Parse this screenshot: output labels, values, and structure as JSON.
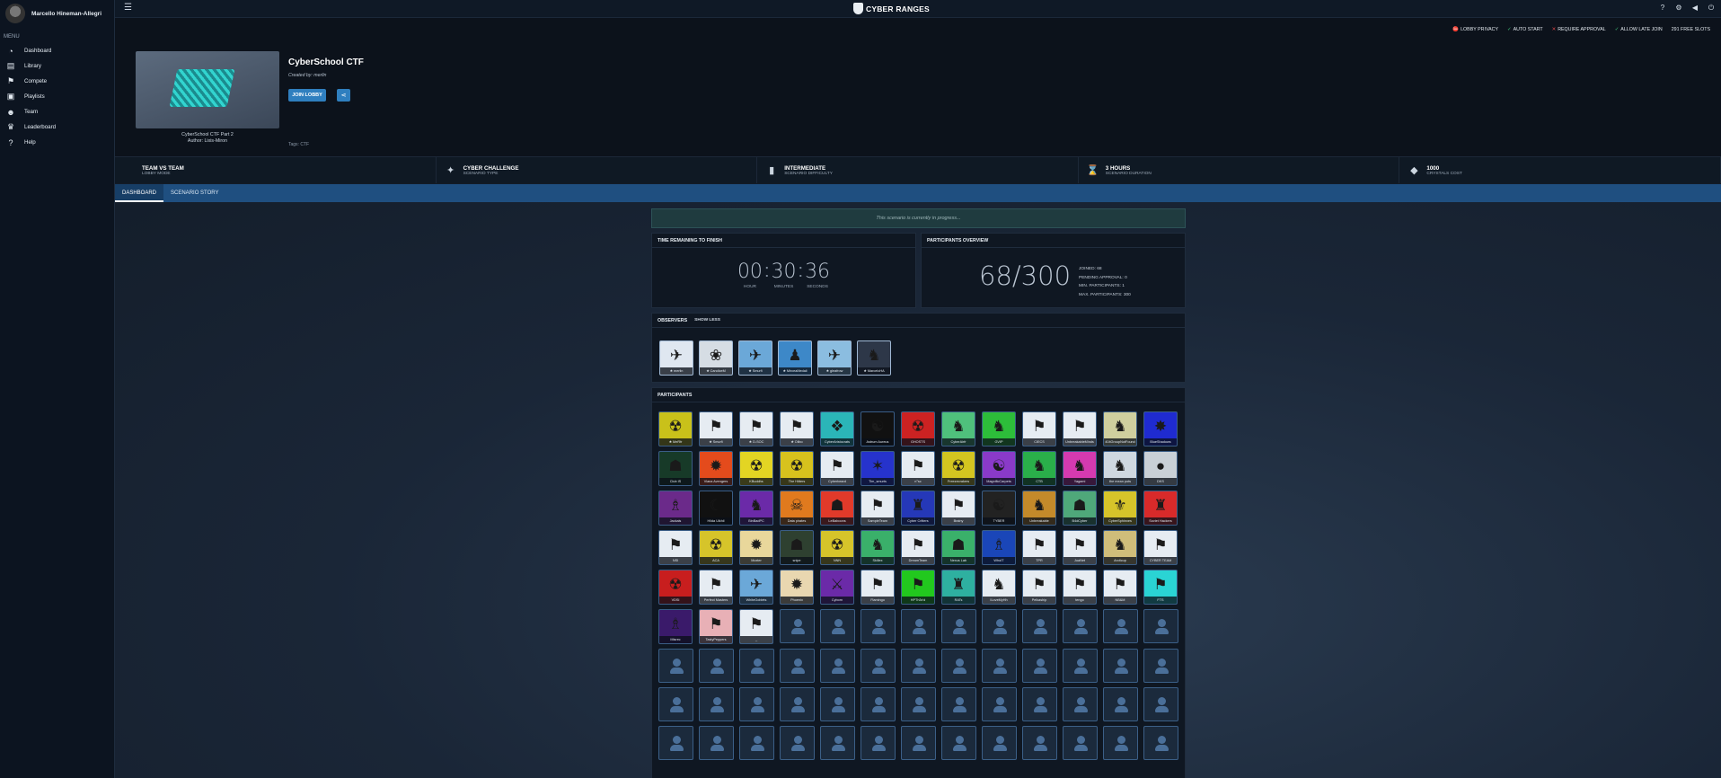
{
  "user": {
    "name": "Marcello Hineman-Allegri"
  },
  "menu": {
    "title": "MENU",
    "items": [
      {
        "label": "Dashboard",
        "icon": "dashboard-icon",
        "glyph": "◔"
      },
      {
        "label": "Library",
        "icon": "library-icon",
        "glyph": "▤"
      },
      {
        "label": "Compete",
        "icon": "compete-icon",
        "glyph": "⚑"
      },
      {
        "label": "Playlists",
        "icon": "playlists-icon",
        "glyph": "▣"
      },
      {
        "label": "Team",
        "icon": "team-icon",
        "glyph": "☻"
      },
      {
        "label": "Leaderboard",
        "icon": "trophy-icon",
        "glyph": "♛"
      },
      {
        "label": "Help",
        "icon": "help-icon",
        "glyph": "?"
      }
    ]
  },
  "brand": {
    "name": "CYBER RANGES"
  },
  "lobby_settings": [
    {
      "label": "LOBBY PRIVACY",
      "mark": "⛔",
      "color": "#e04848"
    },
    {
      "label": "AUTO START",
      "mark": "✓",
      "color": "#3fc57a"
    },
    {
      "label": "REQUIRE APPROVAL",
      "mark": "✕",
      "color": "#e04848"
    },
    {
      "label": "ALLOW LATE JOIN",
      "mark": "✓",
      "color": "#3fc57a"
    },
    {
      "label": "291 FREE SLOTS",
      "mark": "",
      "color": "#e3e9ef"
    }
  ],
  "scenario": {
    "title": "CyberSchool CTF",
    "created_by": "Created by: merlin",
    "thumb_caption": "CyberSchool CTF Part 2",
    "thumb_author": "Author: Lixis-Miron",
    "join_label": "JOIN LOBBY",
    "tags": "Tags: CTF"
  },
  "info": [
    {
      "main": "TEAM VS TEAM",
      "sub": "LOBBY MODE",
      "icon": "team-mode-icon",
      "glyph": ""
    },
    {
      "main": "CYBER CHALLENGE",
      "sub": "SCENARIO TYPE",
      "icon": "challenge-icon",
      "glyph": "✦"
    },
    {
      "main": "INTERMEDIATE",
      "sub": "SCENARIO DIFFICULTY",
      "icon": "difficulty-icon",
      "glyph": "▮"
    },
    {
      "main": "3 HOURS",
      "sub": "SCENARIO DURATION",
      "icon": "hourglass-icon",
      "glyph": "⌛"
    },
    {
      "main": "1000",
      "sub": "CRYSTALS COST",
      "icon": "crystal-icon",
      "glyph": "◆"
    }
  ],
  "tabs": [
    {
      "label": "DASHBOARD"
    },
    {
      "label": "SCENARIO STORY"
    }
  ],
  "status_banner": "This scenario is currently in progress...",
  "timer": {
    "heading": "TIME REMAINING TO FINISH",
    "hours": "00",
    "minutes": "30",
    "seconds": "36",
    "hours_label": "HOUR",
    "minutes_label": "MINUTES",
    "seconds_label": "SECONDS"
  },
  "overview": {
    "heading": "PARTICIPANTS OVERVIEW",
    "count": "68/300",
    "joined": "JOINED: 68",
    "pending": "PENDING APPROVAL: 0",
    "min": "MIN. PARTICIPANTS: 1",
    "max": "MAX. PARTICIPANTS: 300"
  },
  "observers": {
    "heading": "OBSERVERS",
    "toggle": "SHOW LESS",
    "list": [
      {
        "name": "★ merlin",
        "bg": "#dfe7f0",
        "glyph": "✈"
      },
      {
        "name": "★ CandiceM",
        "bg": "#d6dde4",
        "glyph": "❀"
      },
      {
        "name": "★ Smurfi",
        "bg": "#6ba8d8",
        "glyph": "✈"
      },
      {
        "name": "★ MirceaMedali",
        "bg": "#3d88c8",
        "glyph": "♟"
      },
      {
        "name": "★ gleafrow",
        "bg": "#8bbde0",
        "glyph": "✈"
      },
      {
        "name": "★ MarceloHA",
        "bg": "#2d3748",
        "glyph": "♞"
      }
    ]
  },
  "participants": {
    "heading": "PARTICIPANTS",
    "teams": [
      {
        "name": "★ MeRfr",
        "bg": "#c9c11a",
        "glyph": "☢"
      },
      {
        "name": "★ Smurfi",
        "bg": "#e6ecf2",
        "glyph": "⚑"
      },
      {
        "name": "★ D-SOC",
        "bg": "#e6ecf2",
        "glyph": "⚑"
      },
      {
        "name": "★ Olibo",
        "bg": "#e6ecf2",
        "glyph": "⚑"
      },
      {
        "name": "CyberAristocrats",
        "bg": "#2bb5b8",
        "glyph": "❖"
      },
      {
        "name": "Astrum Aureus",
        "bg": "#111111",
        "glyph": "☯"
      },
      {
        "name": "GHOSTS",
        "bg": "#cc2222",
        "glyph": "☢"
      },
      {
        "name": "CyberAirfr",
        "bg": "#4fc07c",
        "glyph": "♞"
      },
      {
        "name": "GVIP",
        "bg": "#2dbd3a",
        "glyph": "♞"
      },
      {
        "name": "CIECS",
        "bg": "#e6ecf2",
        "glyph": "⚑"
      },
      {
        "name": "UnbreakableMinds",
        "bg": "#e6ecf2",
        "glyph": "⚑"
      },
      {
        "name": "404GroupNotFound",
        "bg": "#cfcf9e",
        "glyph": "♞"
      },
      {
        "name": "BlueShadows",
        "bg": "#1f2bd0",
        "glyph": "✸"
      },
      {
        "name": "Club IS",
        "bg": "#173a28",
        "glyph": "☗"
      },
      {
        "name": "Viana Avengers",
        "bg": "#e44b1c",
        "glyph": "✹"
      },
      {
        "name": "KBuddhs",
        "bg": "#e3d523",
        "glyph": "☢"
      },
      {
        "name": "The Hitters",
        "bg": "#d7c21d",
        "glyph": "☢"
      },
      {
        "name": "Cyberbeard",
        "bg": "#e6ecf2",
        "glyph": "⚑"
      },
      {
        "name": "Tim_smurts",
        "bg": "#2633cc",
        "glyph": "✶"
      },
      {
        "name": "n°sc",
        "bg": "#e6ecf2",
        "glyph": "⚑"
      },
      {
        "name": "Freezecrakers",
        "bg": "#d3c520",
        "glyph": "☢"
      },
      {
        "name": "MagnificCarpets",
        "bg": "#8a3ac9",
        "glyph": "☯"
      },
      {
        "name": "CTB",
        "bg": "#2aaf4a",
        "glyph": "♞"
      },
      {
        "name": "Yagami",
        "bg": "#d53ab0",
        "glyph": "♞"
      },
      {
        "name": "the mean pots",
        "bg": "#cfd8e0",
        "glyph": "♞"
      },
      {
        "name": "DKS",
        "bg": "#c9d0d6",
        "glyph": "●"
      },
      {
        "name": "Jackals",
        "bg": "#6b2a8a",
        "glyph": "♗"
      },
      {
        "name": "Hilda Uikhil",
        "bg": "#111111",
        "glyph": "☾"
      },
      {
        "name": "BinBadPC",
        "bg": "#6b2aa8",
        "glyph": "♞"
      },
      {
        "name": "Data pirates",
        "bg": "#e07a1e",
        "glyph": "☠"
      },
      {
        "name": "LeBaboons",
        "bg": "#e13a2a",
        "glyph": "☗"
      },
      {
        "name": "SampleTeam",
        "bg": "#e6ecf2",
        "glyph": "⚑"
      },
      {
        "name": "Cyber Critters",
        "bg": "#2538b8",
        "glyph": "♜"
      },
      {
        "name": "Brainy",
        "bg": "#e6ecf2",
        "glyph": "⚑"
      },
      {
        "name": "TYBER",
        "bg": "#222222",
        "glyph": "☯"
      },
      {
        "name": "Unbreakable",
        "bg": "#c48a2a",
        "glyph": "♞"
      },
      {
        "name": "B4dCyber",
        "bg": "#4fa87a",
        "glyph": "☗"
      },
      {
        "name": "CyberSphinxes",
        "bg": "#d6c42a",
        "glyph": "⚜"
      },
      {
        "name": "Soviet Hackers",
        "bg": "#d82a2a",
        "glyph": "♜"
      },
      {
        "name": "NSI",
        "bg": "#e6ecf2",
        "glyph": "⚑"
      },
      {
        "name": "ACA",
        "bg": "#d6c42a",
        "glyph": "☢"
      },
      {
        "name": "Moxter",
        "bg": "#e9d79b",
        "glyph": "✹"
      },
      {
        "name": "snipe",
        "bg": "#2e4030",
        "glyph": "☗"
      },
      {
        "name": "NNN",
        "bg": "#d6c42a",
        "glyph": "☢"
      },
      {
        "name": "Skillex",
        "bg": "#3ab06a",
        "glyph": "♞"
      },
      {
        "name": "DreamTeam",
        "bg": "#e6ecf2",
        "glyph": "⚑"
      },
      {
        "name": "Nexus Lab",
        "bg": "#3ab06a",
        "glyph": "☗"
      },
      {
        "name": "WhoIT",
        "bg": "#1a46b8",
        "glyph": "♗"
      },
      {
        "name": "TPR",
        "bg": "#e6ecf2",
        "glyph": "⚑"
      },
      {
        "name": "JuaNet",
        "bg": "#e6ecf2",
        "glyph": "⚑"
      },
      {
        "name": "Arcticup",
        "bg": "#cfbd7a",
        "glyph": "♞"
      },
      {
        "name": "CYBER TEAM",
        "bg": "#e6ecf2",
        "glyph": "⚑"
      },
      {
        "name": "VDSI",
        "bg": "#c81e1e",
        "glyph": "☢"
      },
      {
        "name": "Perfect Masters",
        "bg": "#e6ecf2",
        "glyph": "⚑"
      },
      {
        "name": "WhiteGoblets",
        "bg": "#6ba8d8",
        "glyph": "✈"
      },
      {
        "name": "Phoenix",
        "bg": "#e9d7b0",
        "glyph": "✹"
      },
      {
        "name": "Cyborn",
        "bg": "#6b2aa8",
        "glyph": "⚔"
      },
      {
        "name": "Flamingo",
        "bg": "#e6ecf2",
        "glyph": "⚑"
      },
      {
        "name": "HPTh3x'd",
        "bg": "#22c81e",
        "glyph": "⚑"
      },
      {
        "name": "RATs",
        "bg": "#2eb0a0",
        "glyph": "♜"
      },
      {
        "name": "ILoveMyHh",
        "bg": "#e6ecf2",
        "glyph": "♞"
      },
      {
        "name": "Pelkaship",
        "bg": "#e6ecf2",
        "glyph": "⚑"
      },
      {
        "name": "tengo",
        "bg": "#e6ecf2",
        "glyph": "⚑"
      },
      {
        "name": "NB&M",
        "bg": "#e6ecf2",
        "glyph": "⚑"
      },
      {
        "name": "FTS",
        "bg": "#2ad4d4",
        "glyph": "⚑"
      },
      {
        "name": "Misrec",
        "bg": "#3a1a6a",
        "glyph": "♗"
      },
      {
        "name": "TastyPeppers",
        "bg": "#e8b0b6",
        "glyph": "⚑"
      },
      {
        "name": "_",
        "bg": "#e6ecf2",
        "glyph": "⚑"
      }
    ],
    "empty_slots": 49
  }
}
